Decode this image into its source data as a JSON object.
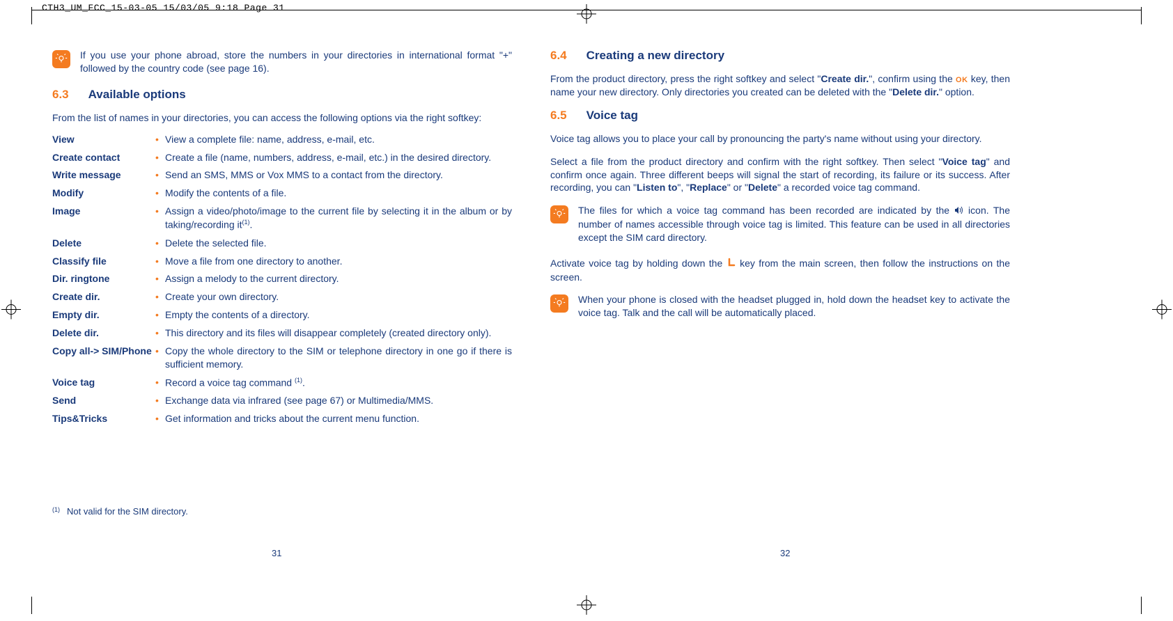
{
  "header": "CTH3_UM_FCC_15-03-05  15/03/05  9:18  Page 31",
  "left": {
    "tip1": "If you use your phone abroad, store the numbers in your directories in international format \"+\" followed by the country code (see page 16).",
    "sec_num": "6.3",
    "sec_title": "Available options",
    "intro": "From the list of names in your directories, you can access the following options via the right softkey:",
    "options": [
      {
        "label": "View",
        "desc": "View a complete file: name, address, e-mail, etc."
      },
      {
        "label": "Create contact",
        "desc": "Create a file (name, numbers, address, e-mail, etc.) in the desired directory."
      },
      {
        "label": "Write message",
        "desc": "Send an SMS, MMS or Vox MMS to a contact from the directory."
      },
      {
        "label": "Modify",
        "desc": "Modify the contents of a file."
      },
      {
        "label": "Image",
        "desc": "Assign a video/photo/image to the current file by selecting it in the album or by taking/recording it",
        "sup": "(1)",
        "trail": "."
      },
      {
        "label": "Delete",
        "desc": "Delete the selected file."
      },
      {
        "label": "Classify file",
        "desc": "Move a file from one directory to another."
      },
      {
        "label": "Dir. ringtone",
        "desc": "Assign a melody to the current directory."
      },
      {
        "label": "Create dir.",
        "desc": "Create your own directory."
      },
      {
        "label": "Empty dir.",
        "desc": "Empty the contents of a directory."
      },
      {
        "label": "Delete dir.",
        "desc": "This directory and its files will disappear completely (created directory only)."
      },
      {
        "label": "Copy all-> SIM/Phone",
        "desc": "Copy the whole directory to the SIM or telephone directory in one go if there is sufficient memory."
      },
      {
        "label": "Voice tag",
        "desc": "Record a voice tag command ",
        "sup": "(1)",
        "trail": "."
      },
      {
        "label": "Send",
        "desc": "Exchange data via infrared (see page 67) or Multimedia/MMS."
      },
      {
        "label": "Tips&Tricks",
        "desc": "Get information and tricks about the current menu function."
      }
    ],
    "footnote_mark": "(1)",
    "footnote": "Not valid for the SIM directory.",
    "page_num": "31"
  },
  "right": {
    "sec64_num": "6.4",
    "sec64_title": "Creating a new directory",
    "p64_pre": "From the product directory, press the right softkey and select \"",
    "p64_b1": "Create dir.",
    "p64_mid1": "\", confirm using the ",
    "p64_ok": "OK",
    "p64_mid2": " key, then name your new directory. Only directories you created can be deleted with the \"",
    "p64_b2": "Delete dir.",
    "p64_end": "\" option.",
    "sec65_num": "6.5",
    "sec65_title": "Voice tag",
    "p65_1": "Voice tag allows you to place your call by pronouncing the party's name without using your directory.",
    "p65_2_pre": "Select a file from the product directory and confirm with the right softkey. Then select \"",
    "p65_2_b1": "Voice tag",
    "p65_2_mid1": "\" and confirm once again. Three different beeps will signal the start of recording, its failure or its success. After recording, you can \"",
    "p65_2_b2": "Listen to",
    "p65_2_mid2": "\", \"",
    "p65_2_b3": "Replace",
    "p65_2_mid3": "\" or \"",
    "p65_2_b4": "Delete",
    "p65_2_end": "\" a recorded voice tag command.",
    "tip2_pre": "The files for which a voice tag command has been recorded are indicated by the ",
    "tip2_post": " icon. The number of names accessible through voice tag is limited. This feature can be used in all directories except the SIM card directory.",
    "p65_3_pre": "Activate voice tag by holding down the ",
    "p65_3_post": " key from the main screen, then follow the instructions on the screen.",
    "tip3": "When your phone is closed with the headset plugged in, hold down the headset key to activate the voice tag. Talk and the call will be automatically placed.",
    "page_num": "32"
  }
}
